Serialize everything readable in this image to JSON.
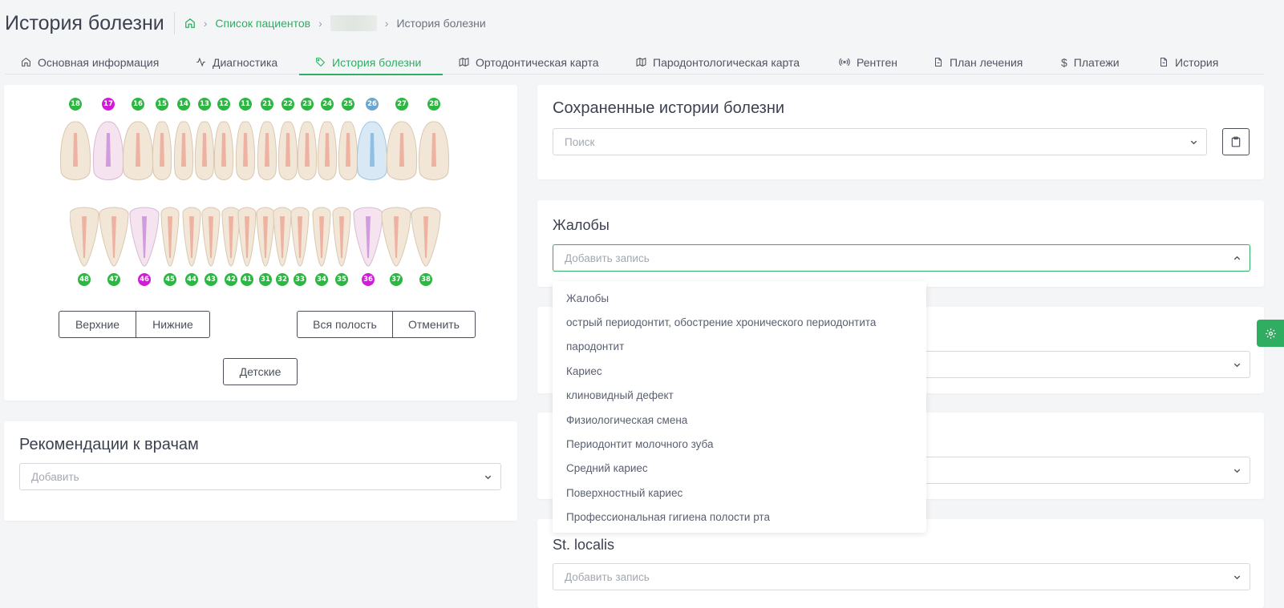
{
  "header": {
    "title": "История болезни",
    "breadcrumb": {
      "patients_link": "Список пациентов",
      "current": "История болезни"
    }
  },
  "tabs": [
    {
      "label": "Основная информация",
      "icon": "home-icon"
    },
    {
      "label": "Диагностика",
      "icon": "activity-icon"
    },
    {
      "label": "История болезни",
      "icon": "tag-icon",
      "active": true
    },
    {
      "label": "Ортодонтическая карта",
      "icon": "map-icon"
    },
    {
      "label": "Пародонтологическая карта",
      "icon": "map-icon"
    },
    {
      "label": "Рентген",
      "icon": "broadcast-icon"
    },
    {
      "label": "План лечения",
      "icon": "file-icon"
    },
    {
      "label": "Платежи",
      "icon": "dollar-icon"
    },
    {
      "label": "История",
      "icon": "file-icon"
    }
  ],
  "dental_chart": {
    "upper_numbers": [
      "18",
      "17",
      "16",
      "15",
      "14",
      "13",
      "12",
      "11",
      "21",
      "22",
      "23",
      "24",
      "25",
      "26",
      "27",
      "28"
    ],
    "upper_colors": [
      "#2cb742",
      "#d21bd8",
      "#2cb742",
      "#2cb742",
      "#2cb742",
      "#2cb742",
      "#2cb742",
      "#2cb742",
      "#2cb742",
      "#2cb742",
      "#2cb742",
      "#2cb742",
      "#2cb742",
      "#6aa6cf",
      "#2cb742",
      "#2cb742"
    ],
    "lower_numbers": [
      "48",
      "47",
      "46",
      "45",
      "44",
      "43",
      "42",
      "41",
      "31",
      "32",
      "33",
      "34",
      "35",
      "36",
      "37",
      "38"
    ],
    "lower_colors": [
      "#2cb742",
      "#2cb742",
      "#d21bd8",
      "#2cb742",
      "#2cb742",
      "#2cb742",
      "#2cb742",
      "#2cb742",
      "#2cb742",
      "#2cb742",
      "#2cb742",
      "#2cb742",
      "#2cb742",
      "#d21bd8",
      "#2cb742",
      "#2cb742"
    ],
    "buttons": {
      "upper": "Верхние",
      "lower": "Нижние",
      "all": "Вся полость",
      "cancel": "Отменить",
      "children": "Детские"
    }
  },
  "recommendations": {
    "title": "Рекомендации к врачам",
    "placeholder": "Добавить"
  },
  "saved_histories": {
    "title": "Сохраненные истории болезни",
    "search_placeholder": "Поиск"
  },
  "complaints": {
    "title": "Жалобы",
    "placeholder": "Добавить запись",
    "options": [
      "Жалобы",
      "острый периодонтит, обострение хронического периодонтита",
      "пародонтит",
      "Кариес",
      "клиновидный дефект",
      "Физиологическая смена",
      "Периодонтит молочного зуба",
      "Средний кариес",
      "Поверхностный кариес",
      "Профессиональная гигиена полости рта"
    ]
  },
  "st_localis": {
    "title": "St. localis",
    "placeholder": "Добавить запись"
  },
  "colors": {
    "accent": "#2fae62",
    "tooth_green": "#2cb742",
    "tooth_magenta": "#d21bd8",
    "tooth_blue": "#6aa6cf"
  }
}
